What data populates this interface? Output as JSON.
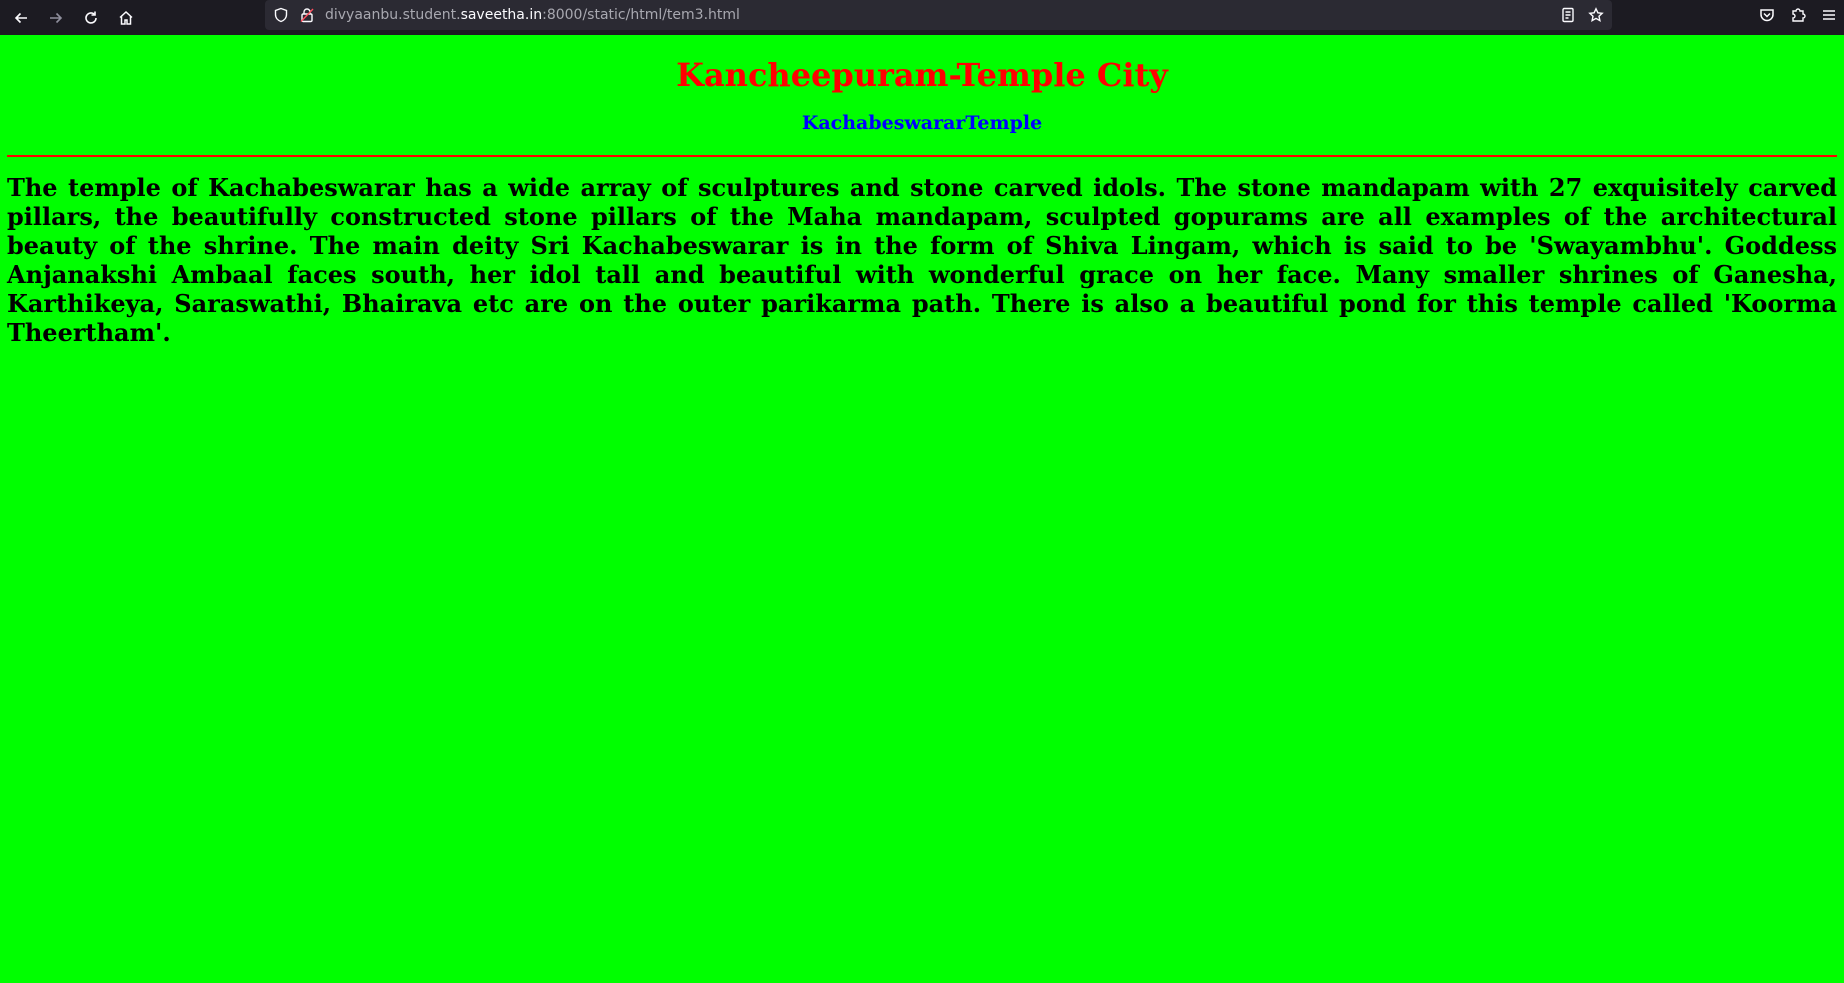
{
  "browser": {
    "url_prefix": "divyaanbu.student.",
    "url_host": "saveetha.in",
    "url_suffix": ":8000/static/html/tem3.html"
  },
  "page": {
    "heading": "Kancheepuram-Temple City",
    "subheading": "KachabeswararTemple",
    "paragraph": "The temple of Kachabeswarar has a wide array of sculptures and stone carved idols. The stone mandapam with 27 exquisitely carved pillars, the beautifully constructed stone pillars of the Maha mandapam, sculpted gopurams are all examples of the architectural beauty of the shrine. The main deity Sri Kachabeswarar is in the form of Shiva Lingam, which is said to be 'Swayambhu'. Goddess Anjanakshi Ambaal faces south, her idol tall and beautiful with wonderful grace on her face. Many smaller shrines of Ganesha, Karthikeya, Saraswathi, Bhairava etc are on the outer parikarma path. There is also a beautiful pond for this temple called 'Koorma Theertham'."
  },
  "colors": {
    "background": "#00ff00",
    "heading": "#ff0000",
    "subheading": "#0000ff",
    "rule": "#ff0000",
    "text": "#000000"
  },
  "icons": {
    "back": "back-arrow-icon",
    "forward": "forward-arrow-icon",
    "reload": "reload-icon",
    "home": "home-icon",
    "tracking": "shield-icon",
    "security": "insecure-lock-icon",
    "reader": "reader-view-icon",
    "bookmark": "star-icon",
    "pocket": "pocket-icon",
    "extensions": "puzzle-icon",
    "menu": "hamburger-menu-icon"
  }
}
